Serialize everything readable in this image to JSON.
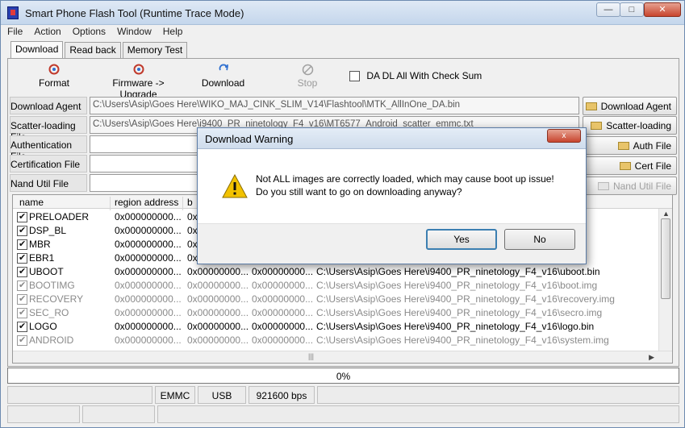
{
  "window": {
    "title": "Smart Phone Flash Tool (Runtime Trace Mode)"
  },
  "menu": [
    "File",
    "Action",
    "Options",
    "Window",
    "Help"
  ],
  "tabs": [
    "Download",
    "Read back",
    "Memory Test"
  ],
  "toolbar": {
    "format": "Format",
    "firmware_upgrade": "Firmware -> Upgrade",
    "download": "Download",
    "stop": "Stop",
    "checksum_label": "DA DL All With Check Sum"
  },
  "fields": {
    "download_agent": {
      "label": "Download Agent",
      "value": "C:\\Users\\Asip\\Goes Here\\WIKO_MAJ_CINK_SLIM_V14\\Flashtool\\MTK_AllInOne_DA.bin"
    },
    "scatter": {
      "label": "Scatter-loading File",
      "value": "C:\\Users\\Asip\\Goes Here\\i9400_PR_ninetology_F4_v16\\MT6577_Android_scatter_emmc.txt"
    },
    "authentication": {
      "label": "Authentication File",
      "value": ""
    },
    "certification": {
      "label": "Certification File",
      "value": ""
    },
    "nand_util": {
      "label": "Nand Util File",
      "value": ""
    }
  },
  "side_buttons": {
    "download_agent": "Download Agent",
    "scatter": "Scatter-loading",
    "auth": "Auth File",
    "cert": "Cert File",
    "nand": "Nand Util File"
  },
  "table": {
    "headers": [
      "name",
      "region address",
      "b"
    ],
    "rows": [
      {
        "name": "PRELOADER",
        "region": "0x000000000...",
        "begin": "0x0000000...",
        "end": "",
        "path": "",
        "checked": true,
        "dim": false
      },
      {
        "name": "DSP_BL",
        "region": "0x000000000...",
        "begin": "0x0000000...",
        "end": "",
        "path": "",
        "checked": true,
        "dim": false
      },
      {
        "name": "MBR",
        "region": "0x000000000...",
        "begin": "0x0000000...",
        "end": "",
        "path": "",
        "checked": true,
        "dim": false
      },
      {
        "name": "EBR1",
        "region": "0x000000000...",
        "begin": "0x0000000...",
        "end": "",
        "path": "",
        "checked": true,
        "dim": false
      },
      {
        "name": "UBOOT",
        "region": "0x000000000...",
        "begin": "0x00000000...",
        "end": "0x00000000...",
        "path": "C:\\Users\\Asip\\Goes Here\\i9400_PR_ninetology_F4_v16\\uboot.bin",
        "checked": true,
        "dim": false
      },
      {
        "name": "BOOTIMG",
        "region": "0x000000000...",
        "begin": "0x00000000...",
        "end": "0x00000000...",
        "path": "C:\\Users\\Asip\\Goes Here\\i9400_PR_ninetology_F4_v16\\boot.img",
        "checked": true,
        "dim": true
      },
      {
        "name": "RECOVERY",
        "region": "0x000000000...",
        "begin": "0x00000000...",
        "end": "0x00000000...",
        "path": "C:\\Users\\Asip\\Goes Here\\i9400_PR_ninetology_F4_v16\\recovery.img",
        "checked": true,
        "dim": true
      },
      {
        "name": "SEC_RO",
        "region": "0x000000000...",
        "begin": "0x00000000...",
        "end": "0x00000000...",
        "path": "C:\\Users\\Asip\\Goes Here\\i9400_PR_ninetology_F4_v16\\secro.img",
        "checked": true,
        "dim": true
      },
      {
        "name": "LOGO",
        "region": "0x000000000...",
        "begin": "0x00000000...",
        "end": "0x00000000...",
        "path": "C:\\Users\\Asip\\Goes Here\\i9400_PR_ninetology_F4_v16\\logo.bin",
        "checked": true,
        "dim": false
      },
      {
        "name": "ANDROID",
        "region": "0x000000000...",
        "begin": "0x00000000...",
        "end": "0x00000000...",
        "path": "C:\\Users\\Asip\\Goes Here\\i9400_PR_ninetology_F4_v16\\system.img",
        "checked": true,
        "dim": true
      }
    ]
  },
  "progress": {
    "text": "0%",
    "value": 0
  },
  "status": {
    "storage": "EMMC",
    "port": "USB",
    "baud": "921600 bps"
  },
  "dialog": {
    "title": "Download Warning",
    "line1": "Not ALL images are correctly loaded, which may cause boot up issue!",
    "line2": "Do you still want to go on downloading anyway?",
    "yes": "Yes",
    "no": "No",
    "close": "x"
  },
  "icons": {
    "format": "format-icon",
    "firmware": "firmware-upgrade-icon",
    "download": "download-icon",
    "stop": "stop-icon",
    "warning": "warning-icon",
    "folder": "folder-icon"
  },
  "colors": {
    "title_gradient_top": "#dfe9f5",
    "close_red": "#c8452e",
    "warning_yellow": "#f2c200",
    "default_button_border": "#3c7fb1"
  }
}
